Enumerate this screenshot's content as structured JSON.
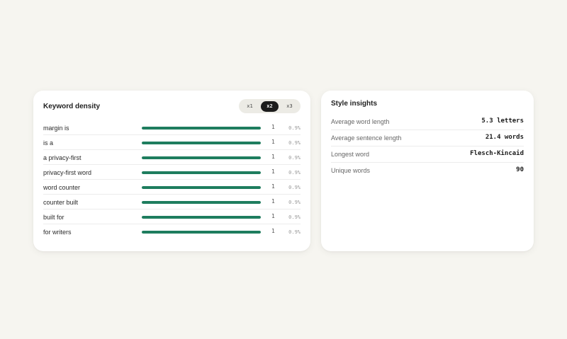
{
  "keyword_density": {
    "title": "Keyword density",
    "ngram_options": [
      {
        "label": "x1",
        "active": false
      },
      {
        "label": "x2",
        "active": true
      },
      {
        "label": "x3",
        "active": false
      }
    ],
    "rows": [
      {
        "phrase": "margin is",
        "count": "1",
        "percent": "0.9%",
        "bar_fraction": 1.0
      },
      {
        "phrase": "is a",
        "count": "1",
        "percent": "0.9%",
        "bar_fraction": 1.0
      },
      {
        "phrase": "a privacy-first",
        "count": "1",
        "percent": "0.9%",
        "bar_fraction": 1.0
      },
      {
        "phrase": "privacy-first word",
        "count": "1",
        "percent": "0.9%",
        "bar_fraction": 1.0
      },
      {
        "phrase": "word counter",
        "count": "1",
        "percent": "0.9%",
        "bar_fraction": 1.0
      },
      {
        "phrase": "counter built",
        "count": "1",
        "percent": "0.9%",
        "bar_fraction": 1.0
      },
      {
        "phrase": "built for",
        "count": "1",
        "percent": "0.9%",
        "bar_fraction": 1.0
      },
      {
        "phrase": "for writers",
        "count": "1",
        "percent": "0.9%",
        "bar_fraction": 1.0
      }
    ],
    "bar_color": "#1e7d5e"
  },
  "style_insights": {
    "title": "Style insights",
    "rows": [
      {
        "label": "Average word length",
        "value": "5.3 letters"
      },
      {
        "label": "Average sentence length",
        "value": "21.4 words"
      },
      {
        "label": "Longest word",
        "value": "Flesch-Kincaid"
      },
      {
        "label": "Unique words",
        "value": "90"
      }
    ]
  }
}
